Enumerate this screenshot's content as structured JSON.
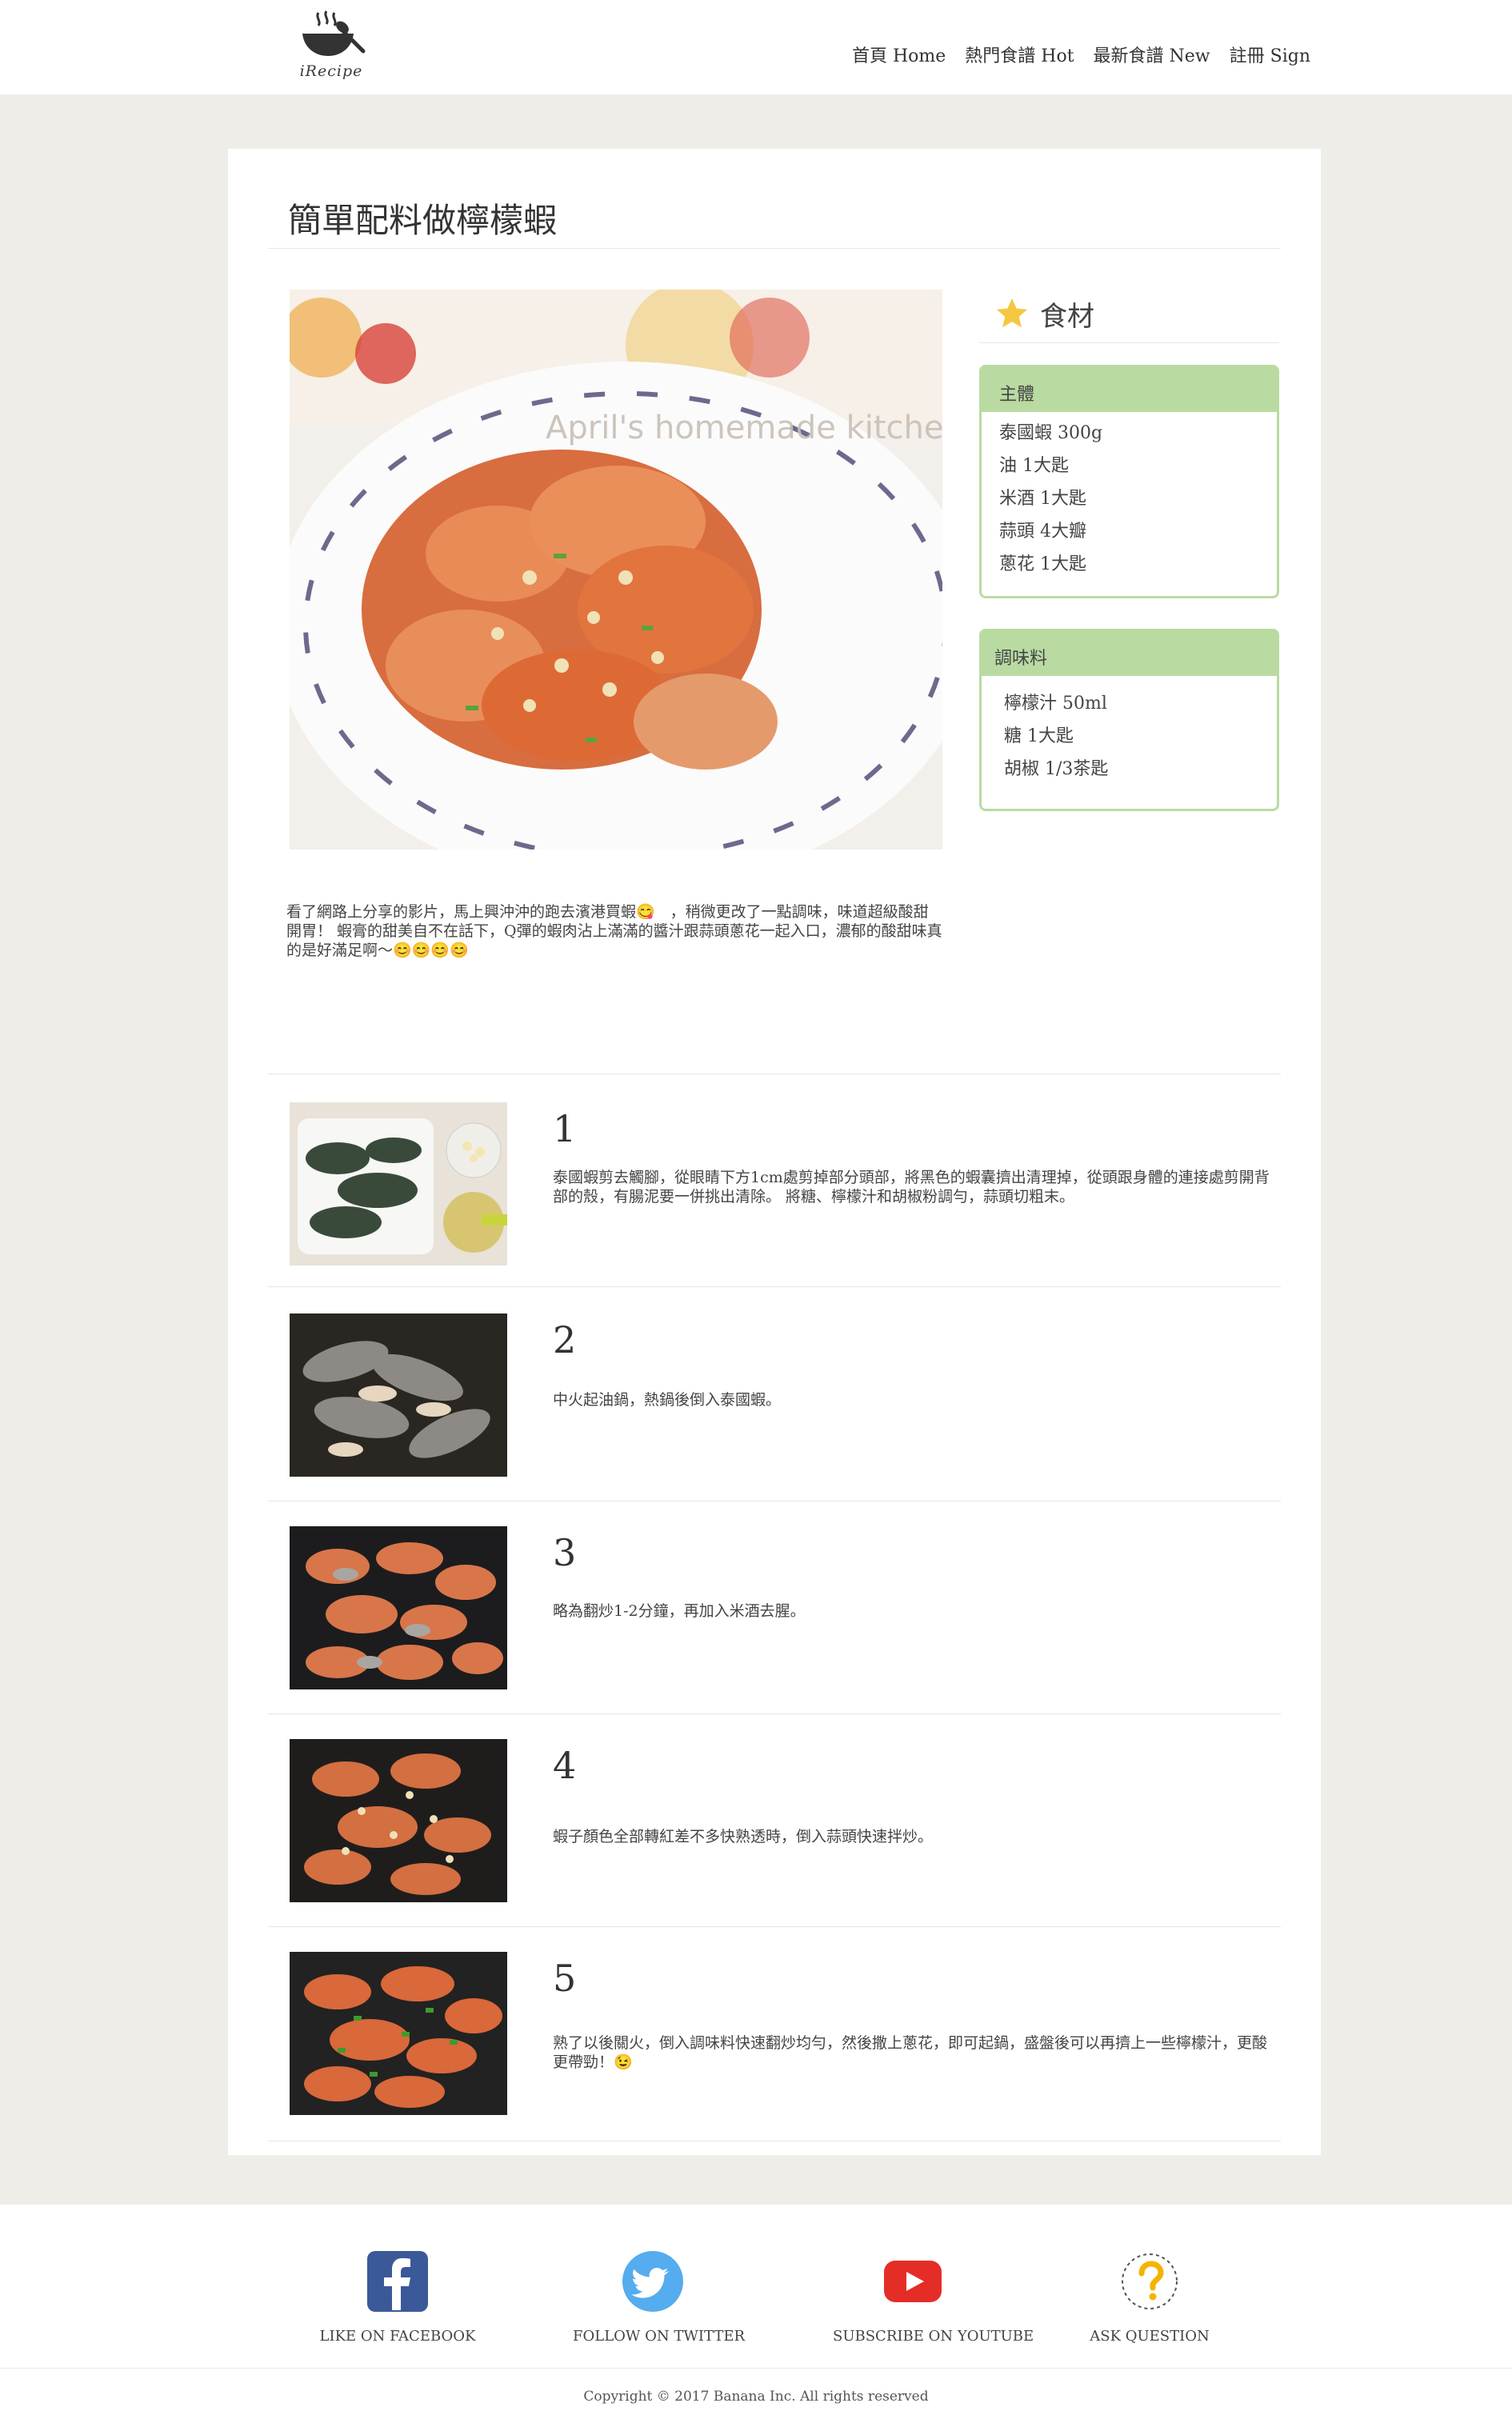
{
  "brand": {
    "logo_text": "iRecipe"
  },
  "nav": {
    "items": [
      {
        "label": "首頁 Home"
      },
      {
        "label": "熱門食譜 Hot"
      },
      {
        "label": "最新食譜 New"
      },
      {
        "label": "註冊 Sign"
      }
    ]
  },
  "recipe": {
    "title": "簡單配料做檸檬蝦",
    "hero_watermark": "April's homemade kitchen",
    "description": "看了網路上分享的影片，馬上興沖沖的跑去濱港買蝦😋　，稍微更改了一點調味，味道超級酸甜開胃！ 蝦膏的甜美自不在話下，Q彈的蝦肉沾上滿滿的醬汁跟蒜頭蔥花一起入口，濃郁的酸甜味真的是好滿足啊～😊😊😊😊"
  },
  "ingredients": {
    "heading": "食材",
    "groups": [
      {
        "name": "主體",
        "items": [
          "泰國蝦 300g",
          "油 1大匙",
          "米酒 1大匙",
          "蒜頭 4大瓣",
          "蔥花 1大匙"
        ]
      },
      {
        "name": "調味料",
        "items": [
          "檸檬汁 50ml",
          "糖 1大匙",
          "胡椒 1/3茶匙"
        ]
      }
    ]
  },
  "steps": [
    {
      "number": "1",
      "text": "泰國蝦剪去觸腳，從眼睛下方1cm處剪掉部分頭部，將黑色的蝦囊擠出清理掉，從頭跟身體的連接處剪開背部的殼，有腸泥要一併挑出清除。 將糖、檸檬汁和胡椒粉調勻，蒜頭切粗末。"
    },
    {
      "number": "2",
      "text": "中火起油鍋，熱鍋後倒入泰國蝦。"
    },
    {
      "number": "3",
      "text": "略為翻炒1-2分鐘，再加入米酒去腥。"
    },
    {
      "number": "4",
      "text": "蝦子顏色全部轉紅差不多快熟透時，倒入蒜頭快速拌炒。"
    },
    {
      "number": "5",
      "text": "熟了以後關火，倒入調味料快速翻炒均勻，然後撒上蔥花，即可起鍋，盛盤後可以再擠上一些檸檬汁，更酸更帶勁！😉"
    }
  ],
  "footer": {
    "social": [
      {
        "label": "LIKE ON FACEBOOK",
        "icon": "facebook-icon"
      },
      {
        "label": "FOLLOW ON TWITTER",
        "icon": "twitter-icon"
      },
      {
        "label": "SUBSCRIBE ON YOUTUBE",
        "icon": "youtube-icon"
      },
      {
        "label": "ASK QUESTION",
        "icon": "question-icon"
      }
    ],
    "copyright": "Copyright © 2017 Banana Inc. All rights reserved"
  },
  "colors": {
    "page_bg": "#eeede8",
    "ingredient_accent": "#b9dba2",
    "facebook": "#3b5998",
    "twitter": "#55acee",
    "youtube": "#e52d27",
    "question": "#f4b400"
  }
}
